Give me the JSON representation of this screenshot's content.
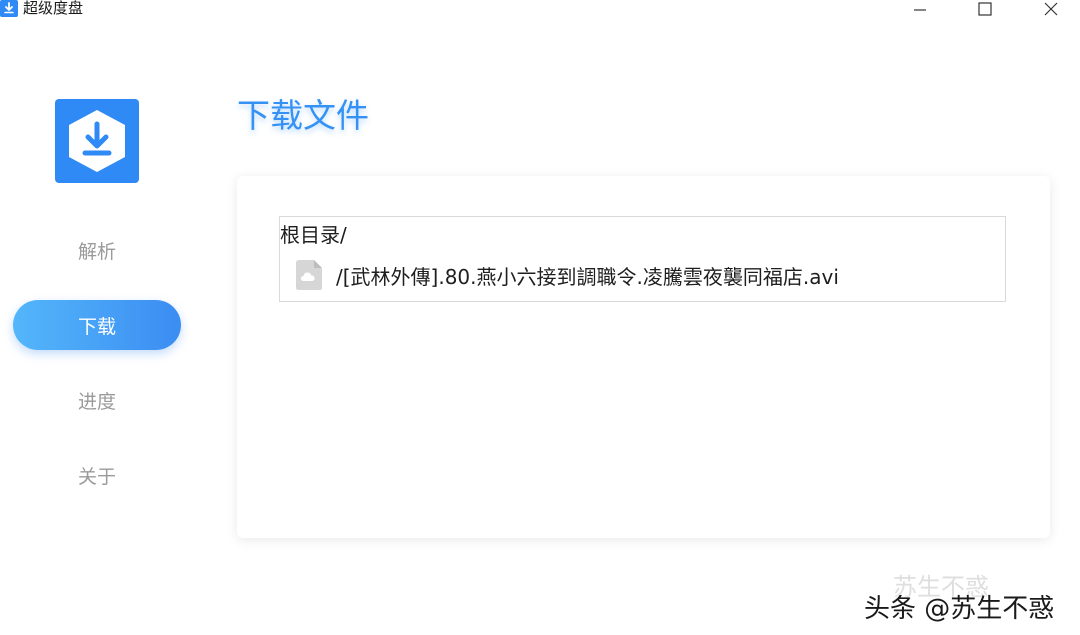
{
  "window": {
    "title": "超级度盘",
    "icons": {
      "app": "download-app-icon",
      "minimize": "minimize-icon",
      "maximize": "maximize-icon",
      "close": "close-icon"
    }
  },
  "sidebar": {
    "logo_icon": "download-logo-icon",
    "items": [
      {
        "label": "解析",
        "active": false
      },
      {
        "label": "下载",
        "active": true
      },
      {
        "label": "进度",
        "active": false
      },
      {
        "label": "关于",
        "active": false
      }
    ]
  },
  "main": {
    "title": "下载文件",
    "tree": {
      "root_label": "根目录/",
      "files": [
        {
          "name": "/[武林外傳].80.燕小六接到調職令.凌騰雲夜襲同福店.avi",
          "icon": "cloud-file-icon"
        }
      ]
    }
  },
  "watermark": {
    "faint_text": "苏生不惑",
    "main_text": "头条 @苏生不惑"
  },
  "colors": {
    "accent": "#3592f4",
    "active_gradient_start": "#54b6fa",
    "active_gradient_end": "#3b8df2",
    "nav_inactive": "#9a9a9a"
  }
}
